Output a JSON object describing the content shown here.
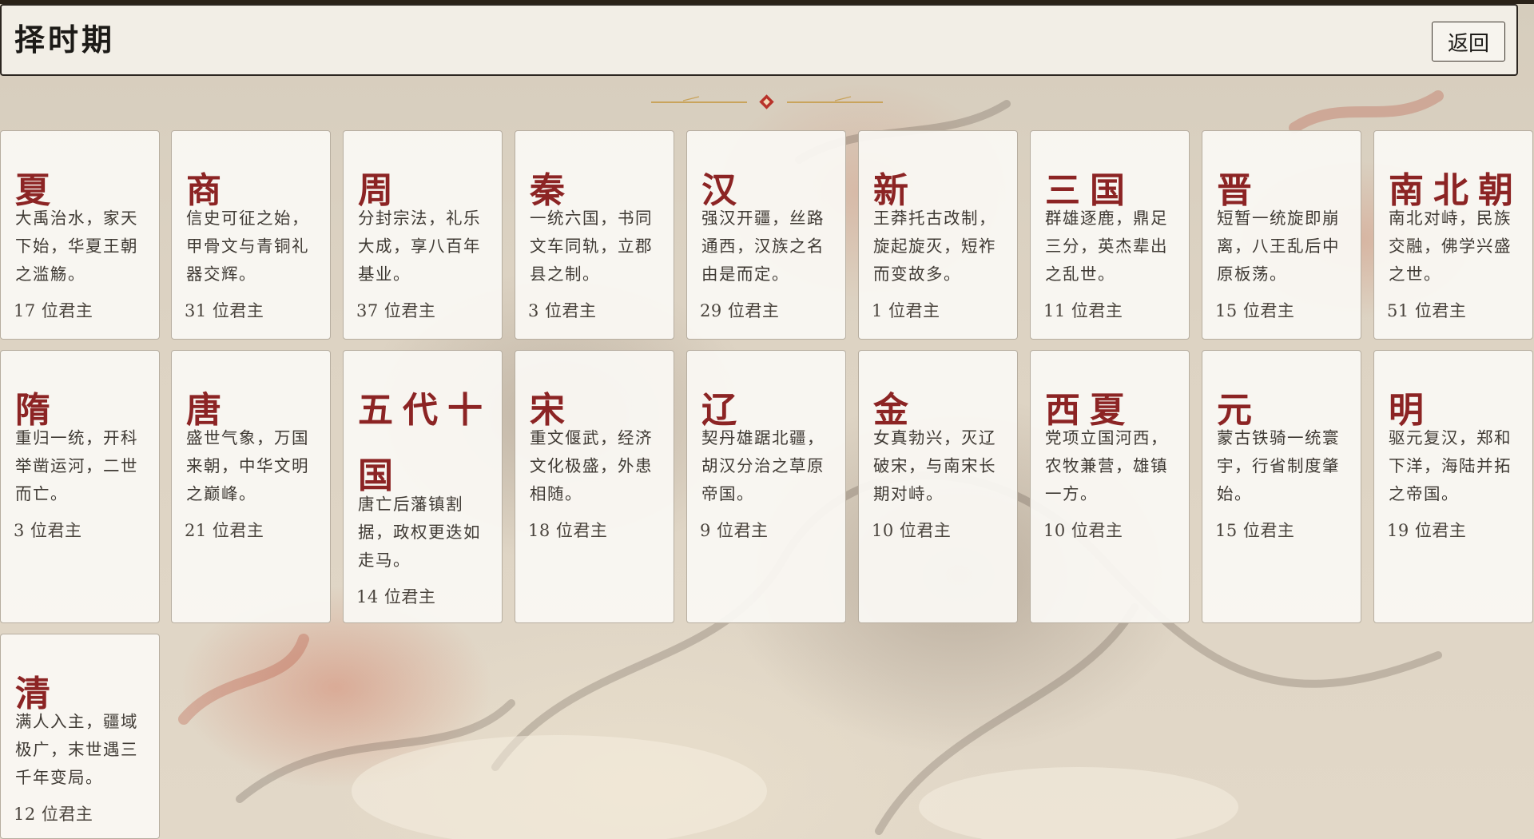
{
  "header": {
    "title": "择时期",
    "back_label": "返回"
  },
  "colors": {
    "header_bg": "#f2eee6",
    "card_bg": "#faf8f3",
    "dynasty_name": "#8c2424",
    "divider_gold": "#c9a45c",
    "divider_diamond": "#b8322a"
  },
  "dynasties": [
    {
      "name": "夏",
      "desc": "大禹治水，家天下始，华夏王朝之滥觞。",
      "count": "17 位君主"
    },
    {
      "name": "商",
      "desc": "信史可征之始，甲骨文与青铜礼器交辉。",
      "count": "31 位君主"
    },
    {
      "name": "周",
      "desc": "分封宗法，礼乐大成，享八百年基业。",
      "count": "37 位君主"
    },
    {
      "name": "秦",
      "desc": "一统六国，书同文车同轨，立郡县之制。",
      "count": "3 位君主"
    },
    {
      "name": "汉",
      "desc": "强汉开疆，丝路通西，汉族之名由是而定。",
      "count": "29 位君主"
    },
    {
      "name": "新",
      "desc": "王莽托古改制，旋起旋灭，短祚而变故多。",
      "count": "1 位君主"
    },
    {
      "name": "三国",
      "desc": "群雄逐鹿，鼎足三分，英杰辈出之乱世。",
      "count": "11 位君主"
    },
    {
      "name": "晋",
      "desc": "短暂一统旋即崩离，八王乱后中原板荡。",
      "count": "15 位君主"
    },
    {
      "name": "南北朝",
      "desc": "南北对峙，民族交融，佛学兴盛之世。",
      "count": "51 位君主"
    },
    {
      "name": "隋",
      "desc": "重归一统，开科举凿运河，二世而亡。",
      "count": "3 位君主"
    },
    {
      "name": "唐",
      "desc": "盛世气象，万国来朝，中华文明之巅峰。",
      "count": "21 位君主"
    },
    {
      "name": "五代十国",
      "desc": "唐亡后藩镇割据，政权更迭如走马。",
      "count": "14 位君主"
    },
    {
      "name": "宋",
      "desc": "重文偃武，经济文化极盛，外患相随。",
      "count": "18 位君主"
    },
    {
      "name": "辽",
      "desc": "契丹雄踞北疆，胡汉分治之草原帝国。",
      "count": "9 位君主"
    },
    {
      "name": "金",
      "desc": "女真勃兴，灭辽破宋，与南宋长期对峙。",
      "count": "10 位君主"
    },
    {
      "name": "西夏",
      "desc": "党项立国河西，农牧兼营，雄镇一方。",
      "count": "10 位君主"
    },
    {
      "name": "元",
      "desc": "蒙古铁骑一统寰宇，行省制度肇始。",
      "count": "15 位君主"
    },
    {
      "name": "明",
      "desc": "驱元复汉，郑和下洋，海陆并拓之帝国。",
      "count": "19 位君主"
    },
    {
      "name": "清",
      "desc": "满人入主，疆域极广，末世遇三千年变局。",
      "count": "12 位君主"
    }
  ]
}
